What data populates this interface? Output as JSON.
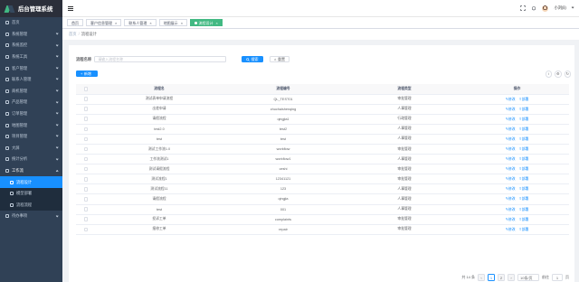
{
  "app": {
    "title": "后台管理系统"
  },
  "sidebar": {
    "items": [
      {
        "label": "首页",
        "expandable": false,
        "open": false
      },
      {
        "label": "系统管理",
        "expandable": true,
        "open": false
      },
      {
        "label": "系统监控",
        "expandable": true,
        "open": false
      },
      {
        "label": "系统工具",
        "expandable": true,
        "open": false
      },
      {
        "label": "客户管理",
        "expandable": true,
        "open": false
      },
      {
        "label": "联系人管理",
        "expandable": true,
        "open": false
      },
      {
        "label": "商机管理",
        "expandable": true,
        "open": false
      },
      {
        "label": "产品管理",
        "expandable": true,
        "open": false
      },
      {
        "label": "订单管理",
        "expandable": true,
        "open": false
      },
      {
        "label": "地图管理",
        "expandable": true,
        "open": false
      },
      {
        "label": "项目管理",
        "expandable": true,
        "open": false
      },
      {
        "label": "大屏",
        "expandable": true,
        "open": false
      },
      {
        "label": "统计分析",
        "expandable": true,
        "open": false
      },
      {
        "label": "工作流",
        "expandable": true,
        "open": true,
        "children": [
          {
            "label": "流程设计",
            "active": true
          },
          {
            "label": "模型部署",
            "active": false
          },
          {
            "label": "流程流程",
            "active": false
          }
        ]
      },
      {
        "label": "待办事项",
        "expandable": true,
        "open": false
      }
    ]
  },
  "navbar": {
    "user": "小刘(li)"
  },
  "tags": [
    {
      "label": "首页",
      "closable": false,
      "active": false
    },
    {
      "label": "客户信息管理",
      "closable": true,
      "active": false
    },
    {
      "label": "联系人管理",
      "closable": true,
      "active": false
    },
    {
      "label": "地图展示",
      "closable": true,
      "active": false
    },
    {
      "label": "流程设计",
      "closable": true,
      "active": true
    }
  ],
  "breadcrumb": {
    "home": "首页",
    "current": "流程设计"
  },
  "search": {
    "label": "流程名称",
    "placeholder": "请输入流程名称",
    "search_btn": "搜索",
    "reset_btn": "重置"
  },
  "toolbar": {
    "add_btn": "新增"
  },
  "table": {
    "headers": [
      "流程名",
      "流程编号",
      "流程类型",
      "操作"
    ],
    "rows": [
      {
        "name": "测试表单申请流程",
        "code": "QL_TEST01",
        "type": "审批管理"
      },
      {
        "name": "出差申请",
        "code": "chuchaishenqing",
        "type": "人事管理"
      },
      {
        "name": "请假流程",
        "code": "qingjia1",
        "type": "行政管理"
      },
      {
        "name": "test2.0",
        "code": "test2",
        "type": "人事管理"
      },
      {
        "name": "test",
        "code": "test",
        "type": "人事管理"
      },
      {
        "name": "测试工作流1.0",
        "code": "workflow",
        "type": "审批管理"
      },
      {
        "name": "工作流测试1",
        "code": "workflow1",
        "type": "人事管理"
      },
      {
        "name": "测试请假流程",
        "code": "ceshi",
        "type": "审批管理"
      },
      {
        "name": "测试流程1",
        "code": "12341121",
        "type": "审批管理"
      },
      {
        "name": "测试流程11",
        "code": "123",
        "type": "人事管理"
      },
      {
        "name": "请假流程",
        "code": "qingjia",
        "type": "人事管理"
      },
      {
        "name": "test",
        "code": "001",
        "type": "人事管理"
      },
      {
        "name": "投诉工单",
        "code": "complaints",
        "type": "审批管理"
      },
      {
        "name": "报修工单",
        "code": "repair",
        "type": "审批管理"
      }
    ],
    "edit_label": "修改",
    "deploy_label": "部署"
  },
  "pagination": {
    "total": "共 14 条",
    "pages": [
      "1",
      "2"
    ],
    "current": "1",
    "page_size": "10条/页",
    "goto": "前往",
    "page_input": "1",
    "page_suffix": "页"
  },
  "colors": {
    "primary": "#1890ff",
    "sidebar_bg": "#304156",
    "tag_active": "#42b983"
  }
}
